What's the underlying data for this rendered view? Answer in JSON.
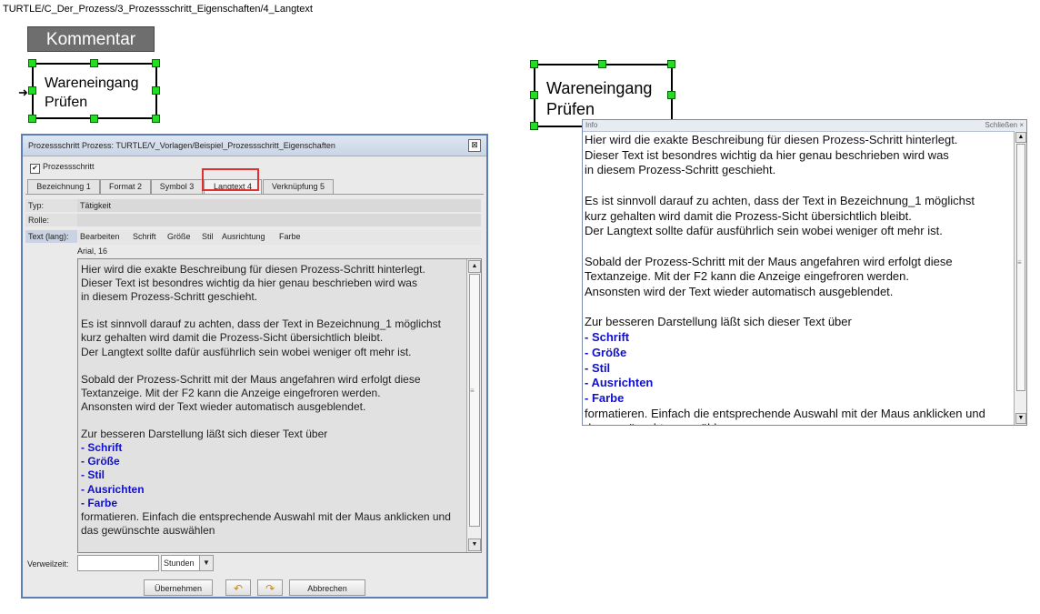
{
  "breadcrumb": "TURTLE/C_Der_Prozess/3_Prozessschritt_Eigenschaften/4_Langtext",
  "comment_label": "Kommentar",
  "process_shape": {
    "line1": "Wareneingang",
    "line2": "Prüfen"
  },
  "dialog": {
    "title": "Prozessschritt Prozess: TURTLE/V_Vorlagen/Beispiel_Prozessschritt_Eigenschaften",
    "close": "⊠",
    "checkbox_label": "Prozessschritt",
    "checkbox_checked": true,
    "tabs": [
      {
        "label": "Bezeichnung 1"
      },
      {
        "label": "Format 2"
      },
      {
        "label": "Symbol 3"
      },
      {
        "label": "Langtext 4",
        "active": true
      },
      {
        "label": "Verknüpfung 5"
      }
    ],
    "fields": {
      "typ_label": "Typ:",
      "typ_value": "Tätigkeit",
      "rolle_label": "Rolle:",
      "rolle_value": "",
      "text_label": "Text (lang):"
    },
    "toolbar": [
      "Bearbeiten",
      "Schrift",
      "Größe",
      "Stil",
      "Ausrichtung",
      "Farbe"
    ],
    "font_info": "Arial, 16",
    "verweilzeit_label": "Verweilzeit:",
    "verweilzeit_value": "",
    "unit": "Stunden",
    "buttons": {
      "ok": "Übernehmen",
      "cancel": "Abbrechen"
    }
  },
  "longtext": {
    "paragraph1": "Hier wird die exakte Beschreibung für diesen Prozess-Schritt hinterlegt.\nDieser Text ist besondres wichtig da hier genau beschrieben wird was\nin diesem Prozess-Schritt geschieht.",
    "paragraph2": "Es ist sinnvoll darauf zu achten, dass der Text in Bezeichnung_1 möglichst\nkurz gehalten wird damit die Prozess-Sicht übersichtlich bleibt.\nDer Langtext sollte dafür ausführlich sein wobei weniger oft mehr ist.",
    "paragraph3": "Sobald der Prozess-Schritt mit der Maus angefahren wird erfolgt diese\nTextanzeige. Mit der F2 kann die Anzeige eingefroren werden.\nAnsonsten wird der Text wieder automatisch ausgeblendet.",
    "paragraph4": "Zur besseren Darstellung läßt sich dieser Text über",
    "list": [
      "- Schrift",
      "- Größe",
      "- Stil",
      "- Ausrichten",
      "- Farbe"
    ],
    "closing": "formatieren. Einfach die entsprechende Auswahl mit der Maus anklicken und\ndas gewünschte auswählen"
  },
  "info_panel": {
    "title": "Info",
    "close": "Schließen ×"
  },
  "colors": {
    "handle": "#22dd22",
    "highlight": "#e03030",
    "list_text": "#1010cc",
    "kommentar_bg": "#6e6e6e"
  }
}
